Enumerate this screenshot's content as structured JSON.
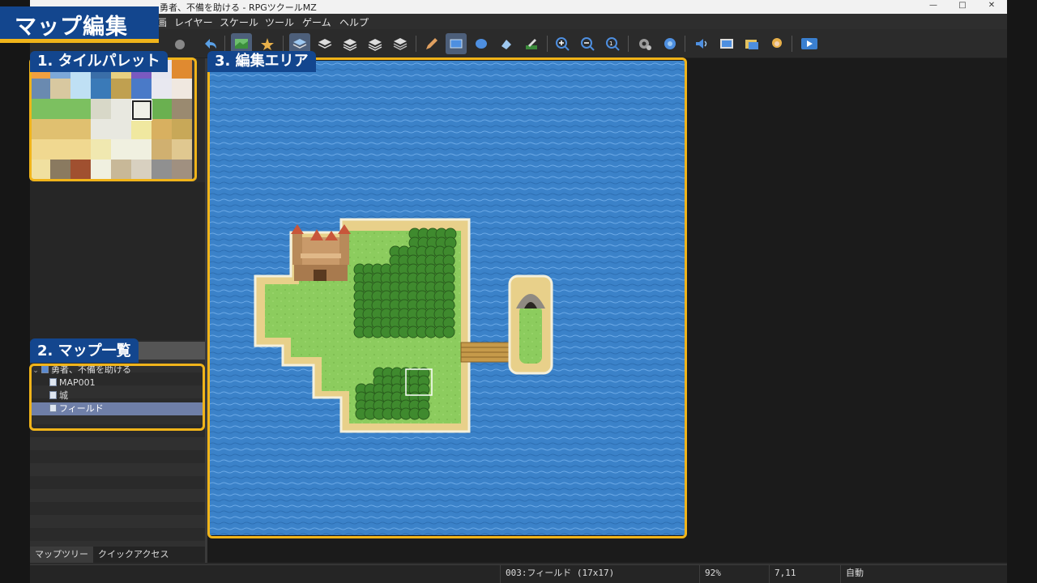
{
  "window": {
    "title": "勇者、不備を助ける - RPGツクールMZ",
    "controls": [
      "—",
      "□",
      "✕"
    ]
  },
  "menu": {
    "items": [
      "画",
      "レイヤー",
      "スケール",
      "ツール",
      "ゲーム",
      "ヘルプ"
    ]
  },
  "toolbar": {
    "buttons": [
      "undo-icon",
      "map-mode-icon",
      "event-mode-icon",
      "layer1-icon",
      "layer2-icon",
      "layer3-icon",
      "layer4-icon",
      "auto-layer-icon",
      "pencil-icon",
      "rectangle-icon",
      "ellipse-icon",
      "fill-icon",
      "shadow-pen-icon",
      "zoom-in-icon",
      "zoom-out-icon",
      "zoom-reset-icon",
      "database-icon",
      "plugin-icon",
      "sound-icon",
      "event-search-icon",
      "resource-icon",
      "character-generator-icon",
      "playtest-icon"
    ]
  },
  "overlay": {
    "banner": "マップ編集",
    "label_palette": "1. タイルパレット",
    "label_edit": "3. 編集エリア",
    "label_list": "2. マップ一覧",
    "accent": "#f0b41a",
    "label_bg": "#13468e"
  },
  "map_tree": {
    "project": "勇者、不備を助ける",
    "maps": [
      "MAP001",
      "城",
      "フィールド"
    ],
    "selected": "フィールド"
  },
  "tabs": {
    "map_tree": "マップツリー",
    "quick_access": "クイックアクセス"
  },
  "status": {
    "map": "003:フィールド (17x17)",
    "zoom": "92%",
    "coords": "7,11",
    "mode": "自動"
  },
  "colors": {
    "sea": "#3b82c9",
    "grass": "#8ccc5e",
    "sand": "#e8d08a",
    "selection": "#6f7fa8"
  }
}
